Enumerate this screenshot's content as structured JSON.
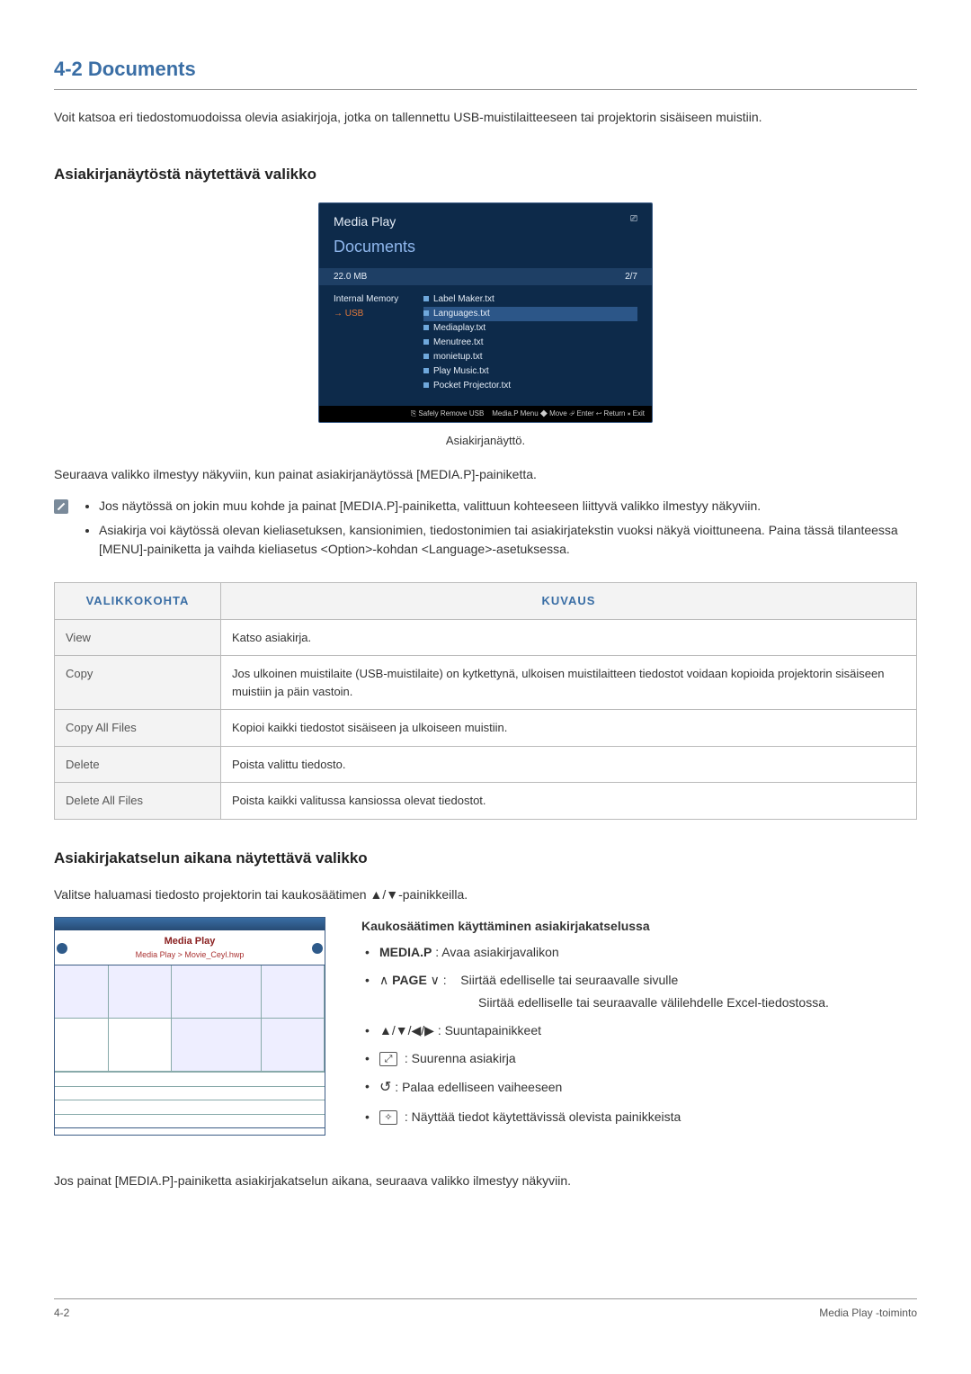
{
  "section": {
    "number_title": "4-2   Documents"
  },
  "intro": "Voit katsoa eri tiedostomuodoissa olevia asiakirjoja, jotka on tallennettu USB-muistilaitteeseen tai projektorin sisäiseen muistiin.",
  "sub1_heading": "Asiakirjanäytöstä näytettävä valikko",
  "mp_screenshot": {
    "title": "Media Play",
    "section": "Documents",
    "size_bar_left": "22.0 MB",
    "size_bar_right": "2/7",
    "left_internal": "Internal Memory",
    "left_usb": "→ USB",
    "files": [
      "Label Maker.txt",
      "Languages.txt",
      "Mediaplay.txt",
      "Menutree.txt",
      "monietup.txt",
      "Play Music.txt",
      "Pocket Projector.txt"
    ],
    "footer_left": "⎘ Safely Remove USB",
    "footer_right": "Media.P Menu  ◆ Move  ⏎ Enter  ↩ Return  ⨯ Exit"
  },
  "caption": "Asiakirjanäyttö.",
  "after_caption": "Seuraava valikko ilmestyy näkyviin, kun painat asiakirjanäytössä [MEDIA.P]-painiketta.",
  "notes": [
    "Jos näytössä on jokin muu kohde ja painat [MEDIA.P]-painiketta, valittuun kohteeseen liittyvä valikko ilmestyy näkyviin.",
    "Asiakirja voi käytössä olevan kieliasetuksen, kansionimien, tiedostonimien tai asiakirjatekstin vuoksi näkyä vioittuneena. Paina tässä tilanteessa [MENU]-painiketta ja vaihda kieliasetus <Option>-kohdan <Language>-asetuksessa."
  ],
  "table": {
    "head_menu": "VALIKKOKOHTA",
    "head_desc": "KUVAUS",
    "rows": [
      {
        "menu": "View",
        "desc": "Katso asiakirja."
      },
      {
        "menu": "Copy",
        "desc": "Jos ulkoinen muistilaite (USB-muistilaite) on kytkettynä, ulkoisen muistilaitteen tiedostot voidaan kopioida projektorin sisäiseen muistiin ja päin vastoin."
      },
      {
        "menu": "Copy All Files",
        "desc": "Kopioi kaikki tiedostot sisäiseen ja ulkoiseen muistiin."
      },
      {
        "menu": "Delete",
        "desc": "Poista valittu tiedosto."
      },
      {
        "menu": "Delete All Files",
        "desc": "Poista kaikki valitussa kansiossa olevat tiedostot."
      }
    ]
  },
  "sub2_heading": "Asiakirjakatselun aikana näytettävä valikko",
  "sub2_intro": "Valitse haluamasi tiedosto projektorin tai kaukosäätimen ▲/▼-painikkeilla.",
  "docview": {
    "title": "Media Play",
    "subtitle": "Media Play > Movie_Ceyl.hwp",
    "row1": {
      "l": "",
      "r": ""
    },
    "row2": {
      "l": "",
      "r": ""
    },
    "row3": {
      "l": "",
      "r": ""
    },
    "row4": {
      "l": "",
      "r": ""
    },
    "footer_left": "",
    "footer_right": ""
  },
  "remote": {
    "heading": "Kaukosäätimen käyttäminen asiakirjakatselussa",
    "items": {
      "mediap_label": "MEDIA.P",
      "mediap_desc": ": Avaa asiakirjavalikon",
      "page_prefix": "∧ ",
      "page_label": "PAGE",
      "page_suffix": " ∨ :",
      "page_desc1": "Siirtää edelliselle tai seuraavalle sivulle",
      "page_desc2": "Siirtää edelliselle tai seuraavalle välilehdelle Excel-tiedostossa.",
      "arrows_label": "▲/▼/◀/▶",
      "arrows_desc": ": Suuntapainikkeet",
      "zoom_desc": ": Suurenna asiakirja",
      "return_desc": ": Palaa edelliseen vaiheeseen",
      "info_desc": ": Näyttää tiedot käytettävissä olevista painikkeista"
    }
  },
  "closing": "Jos painat [MEDIA.P]-painiketta asiakirjakatselun aikana, seuraava valikko ilmestyy näkyviin.",
  "footer": {
    "left": "4-2",
    "right": "Media Play -toiminto"
  }
}
